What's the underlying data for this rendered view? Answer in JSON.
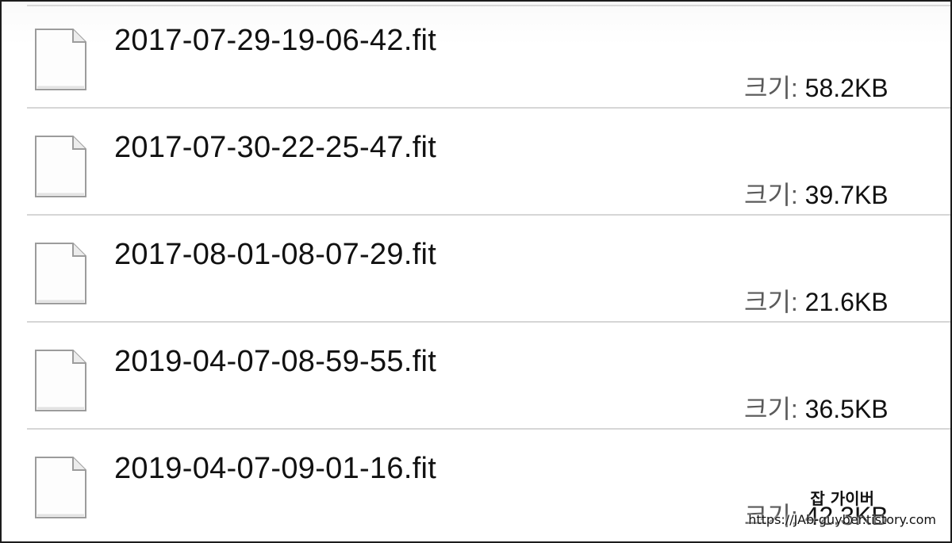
{
  "files": [
    {
      "name": "2017-07-29-19-06-42.fit",
      "size_label": "크기:",
      "size_value": "58.2KB",
      "icon": "document-icon"
    },
    {
      "name": "2017-07-30-22-25-47.fit",
      "size_label": "크기:",
      "size_value": "39.7KB",
      "icon": "document-icon"
    },
    {
      "name": "2017-08-01-08-07-29.fit",
      "size_label": "크기:",
      "size_value": "21.6KB",
      "icon": "document-icon"
    },
    {
      "name": "2019-04-07-08-59-55.fit",
      "size_label": "크기:",
      "size_value": "36.5KB",
      "icon": "document-icon"
    },
    {
      "name": "2019-04-07-09-01-16.fit",
      "size_label": "크기:",
      "size_value": "42.3KB",
      "icon": "document-icon"
    }
  ],
  "watermark": {
    "title": "잡 가이버",
    "url": "https://JAb-guyber.tistory.com"
  },
  "colors": {
    "frame_border": "#1c1c1c",
    "divider": "#d6d6d6",
    "text": "#111111",
    "label": "#5a5a5a"
  }
}
